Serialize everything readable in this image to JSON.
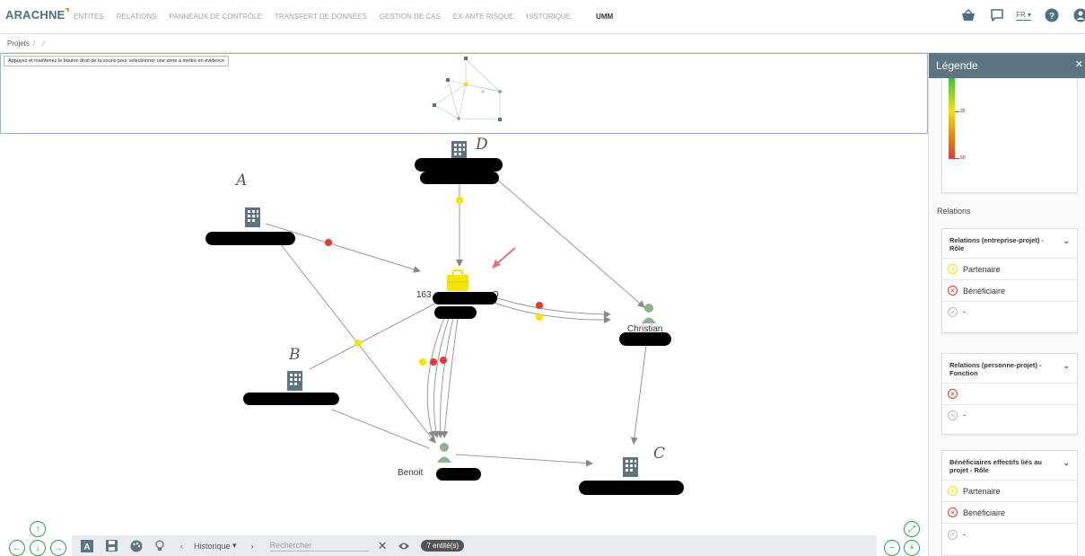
{
  "app": {
    "logo": "ARACHNE"
  },
  "nav": {
    "items": [
      "ENTITÉS",
      "RELATIONS",
      "PANNEAUX DE CONTRÔLE",
      "TRANSFERT DE DONNÉES",
      "GESTION DE CAS",
      "EX-ANTE RISQUE",
      "HISTORIQUE"
    ],
    "active": "UMM"
  },
  "header": {
    "lang": "FR"
  },
  "breadcrumb": {
    "root": "Projets",
    "sep": "/"
  },
  "minimap": {
    "hint": "Appuyez et maintenez le bouton droit de la souris pour sélectionner une zone à mettre en évidence"
  },
  "graph": {
    "labels": {
      "project_prefix": "163",
      "project_suffix": "O",
      "christian": "Christian",
      "benoit": "Benoit"
    },
    "annotations": {
      "a": "A",
      "b": "B",
      "c": "C",
      "d": "D"
    }
  },
  "bottombar": {
    "history": "Historique",
    "search_placeholder": "Rechercher",
    "count": "7 entité(s)"
  },
  "legend": {
    "title": "Légende",
    "scale": [
      "25",
      "50"
    ],
    "relations_title": "Relations",
    "cards": [
      {
        "title": "Relations (entreprise-projet) - Rôle",
        "rows": [
          {
            "type": "partner",
            "label": "Partenaire"
          },
          {
            "type": "benef",
            "label": "Bénéficiaire"
          },
          {
            "type": "none",
            "label": "-"
          }
        ]
      },
      {
        "title": "Relations (personne-projet) - Fonction",
        "rows": [
          {
            "type": "benef",
            "label": ""
          },
          {
            "type": "none",
            "label": "-"
          }
        ]
      },
      {
        "title": "Bénéficiaires effectifs liés au projet - Rôle",
        "rows": [
          {
            "type": "partner",
            "label": "Partenaire"
          },
          {
            "type": "benef",
            "label": "Bénéficiaire"
          },
          {
            "type": "none",
            "label": "-"
          }
        ]
      }
    ]
  },
  "colors": {
    "accent": "#5d7580",
    "green": "#2ea34a",
    "yellow": "#f5e300",
    "red": "#e53935",
    "building": "#5d7580",
    "person": "#8fb38f"
  }
}
